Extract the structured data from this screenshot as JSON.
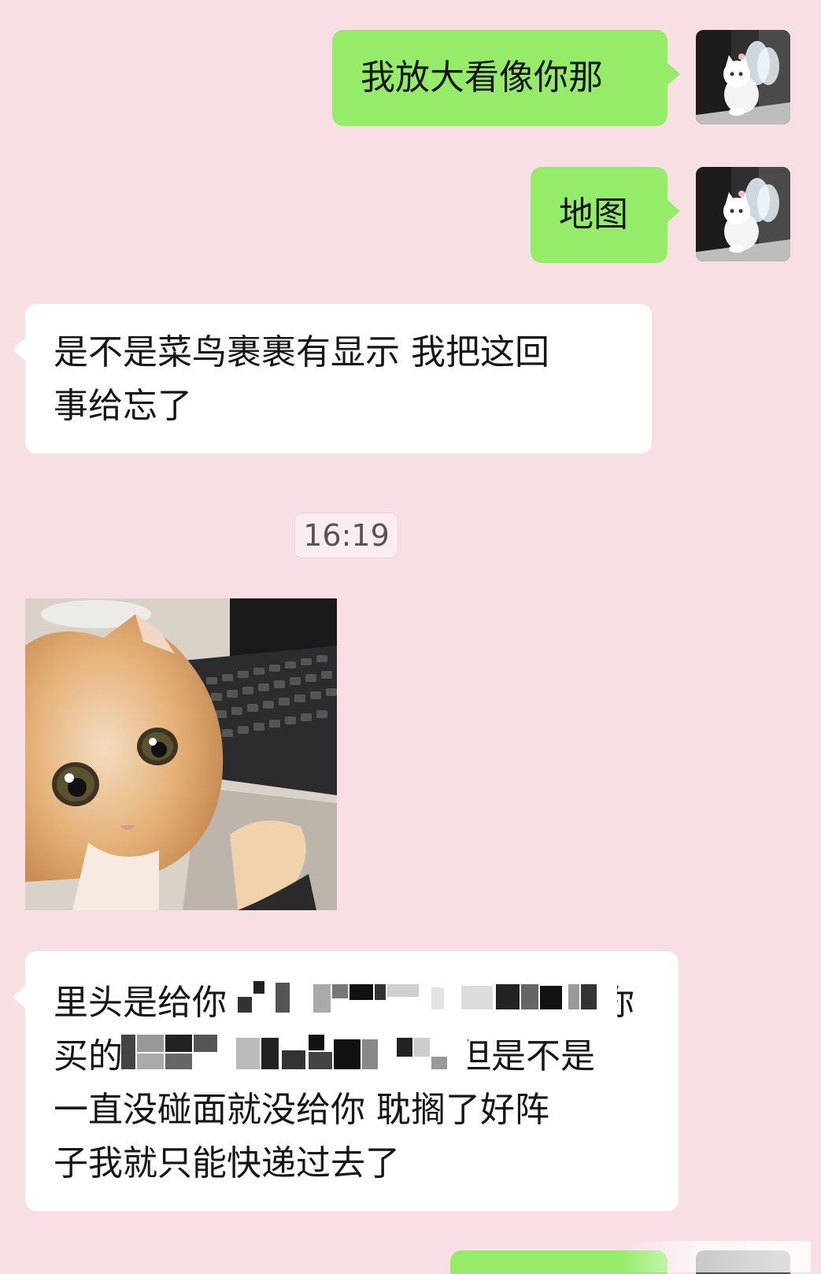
{
  "messages": [
    {
      "side": "out",
      "text": "我放大看像你那"
    },
    {
      "side": "out",
      "text": "地图"
    },
    {
      "side": "in",
      "lines": [
        "是不是菜鸟裹裹有显示 我把这回",
        "事给忘了"
      ]
    },
    {
      "side": "in",
      "lines": [
        "里头是给你",
        "你",
        "买的",
        "但是不是",
        "一直没碰面就没给你 耽搁了好阵",
        "子我就只能快递过去了"
      ]
    }
  ],
  "timestamp": "16:19",
  "colors": {
    "background": "#f8dfe4",
    "outgoing_bubble": "#95ec69",
    "incoming_bubble": "#ffffff"
  },
  "icons": {
    "self_avatar": "white-kitten-with-wings",
    "sticker": "orange-cat-at-laptop"
  }
}
